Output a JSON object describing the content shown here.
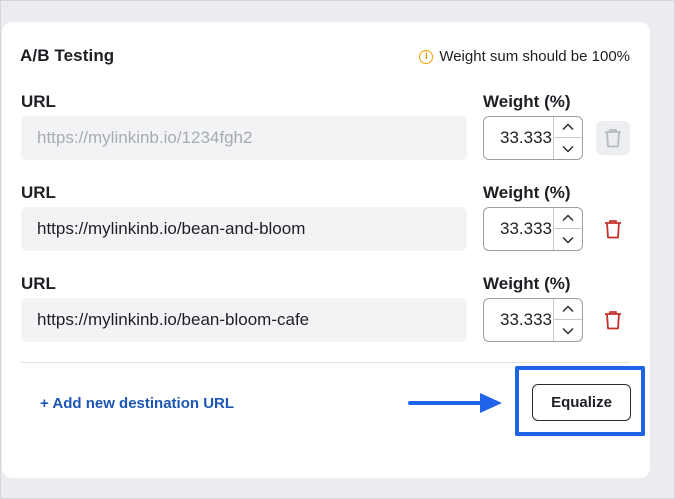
{
  "section": {
    "title": "A/B Testing",
    "notice": "Weight sum should be 100%",
    "notice_icon": "info-icon",
    "notice_color": "#f0a400"
  },
  "rows": [
    {
      "url_label": "URL",
      "weight_label": "Weight (%)",
      "url_value": "",
      "url_placeholder": "https://mylinkinb.io/1234fgh2",
      "weight_value": "33.333",
      "delete_enabled": false
    },
    {
      "url_label": "URL",
      "weight_label": "Weight (%)",
      "url_value": "https://mylinkinb.io/bean-and-bloom",
      "url_placeholder": "",
      "weight_value": "33.333",
      "delete_enabled": true
    },
    {
      "url_label": "URL",
      "weight_label": "Weight (%)",
      "url_value": "https://mylinkinb.io/bean-bloom-cafe",
      "url_placeholder": "",
      "weight_value": "33.333",
      "delete_enabled": true
    }
  ],
  "footer": {
    "add_link": "+ Add new destination URL",
    "equalize_label": "Equalize"
  },
  "colors": {
    "accent_link": "#1d56b4",
    "delete_red": "#c4312b",
    "highlight_blue": "#1e63e8"
  }
}
